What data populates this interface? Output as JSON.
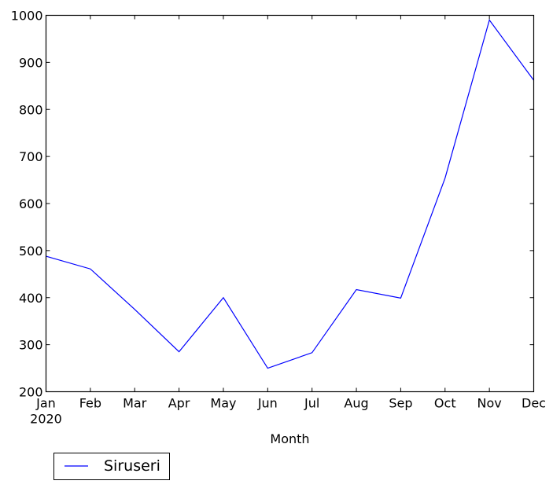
{
  "chart_data": {
    "type": "line",
    "title": "",
    "xlabel": "Month",
    "ylabel": "",
    "categories": [
      "Jan",
      "Feb",
      "Mar",
      "Apr",
      "May",
      "Jun",
      "Jul",
      "Aug",
      "Sep",
      "Oct",
      "Nov",
      "Dec"
    ],
    "x_sublabel": "2020",
    "ylim": [
      200,
      1000
    ],
    "yticks": [
      200,
      300,
      400,
      500,
      600,
      700,
      800,
      900,
      1000
    ],
    "grid": false,
    "legend_position": "below-left",
    "series": [
      {
        "name": "Siruseri",
        "color": "#0000ff",
        "values": [
          488,
          461,
          375,
          285,
          400,
          250,
          283,
          417,
          399,
          654,
          990,
          862
        ]
      }
    ]
  }
}
